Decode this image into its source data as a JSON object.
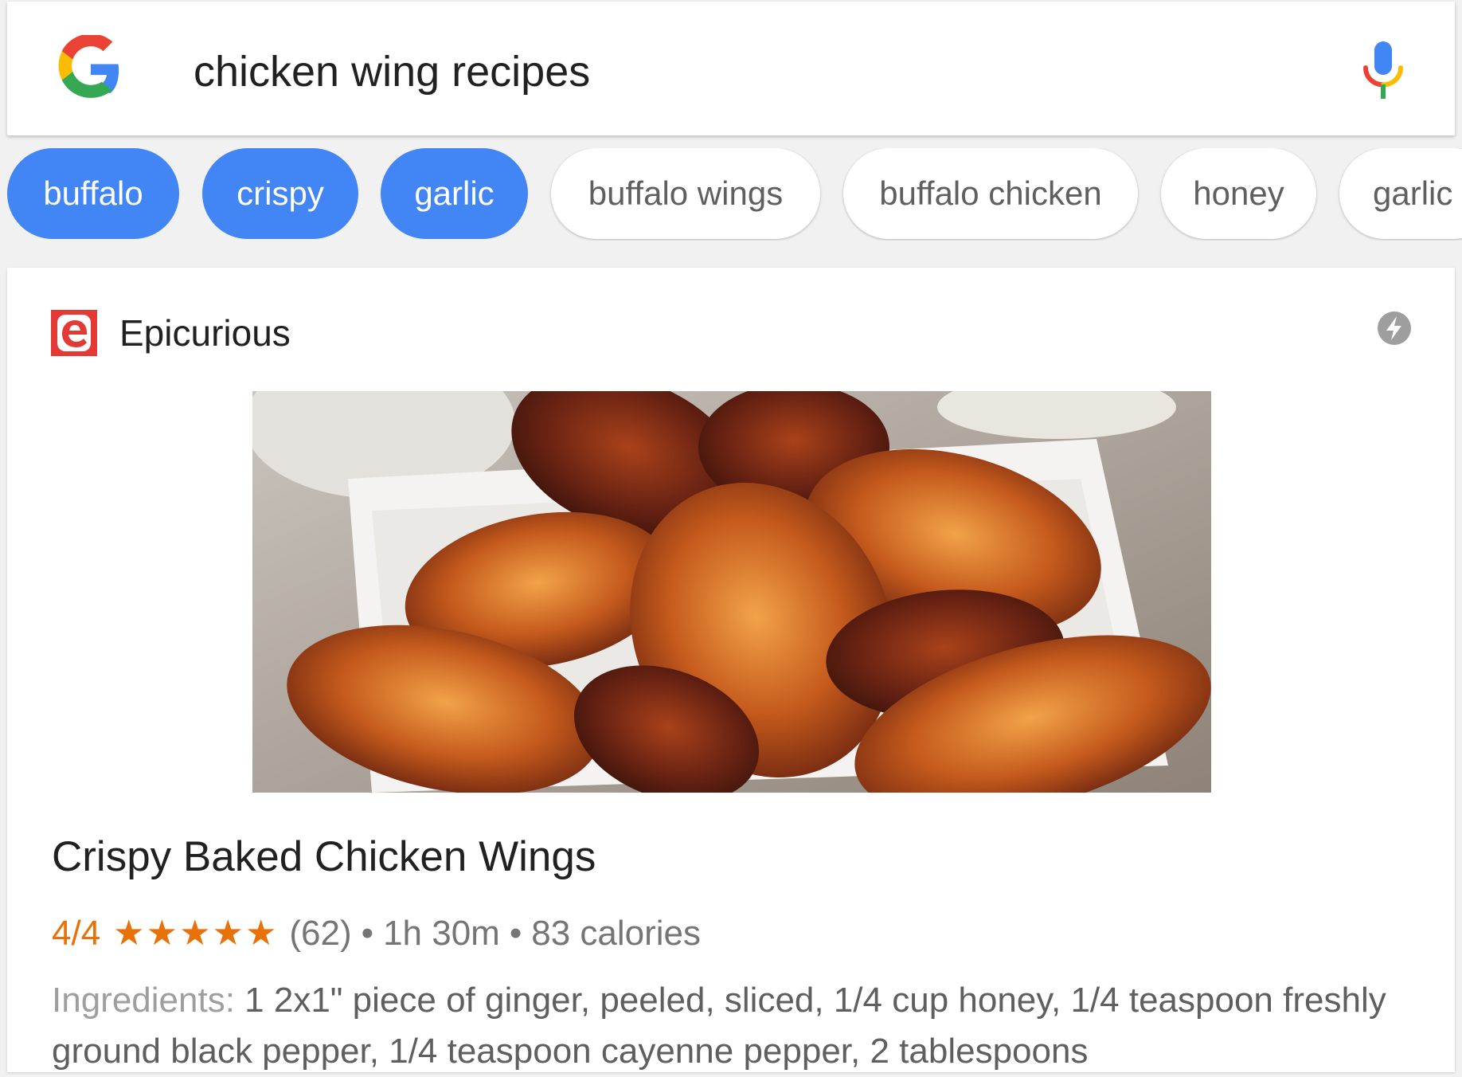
{
  "search": {
    "query": "chicken wing recipes",
    "colors": {
      "blue": "#4285f4",
      "red": "#ea4335",
      "yellow": "#fbbc05",
      "green": "#34a853"
    }
  },
  "chips": [
    {
      "label": "buffalo",
      "active": true
    },
    {
      "label": "crispy",
      "active": true
    },
    {
      "label": "garlic",
      "active": true
    },
    {
      "label": "buffalo wings",
      "active": false
    },
    {
      "label": "buffalo chicken",
      "active": false
    },
    {
      "label": "honey",
      "active": false
    },
    {
      "label": "garlic",
      "active": false
    }
  ],
  "result": {
    "source": "Epicurious",
    "source_icon": "epicurious-logo",
    "amp_icon": "lightning-bolt-icon",
    "image_subject": "baked chicken wings",
    "title": "Crispy Baked Chicken Wings",
    "rating": "4/4",
    "stars": "★★★★★",
    "review_count": "(62)",
    "separator": "•",
    "time": "1h 30m",
    "calories": "83 calories",
    "ingredients_label": "Ingredients:",
    "ingredients_text": "1 2x1\" piece of ginger, peeled, sliced, 1/4 cup honey, 1/4 teaspoon freshly ground black pepper, 1/4 teaspoon cayenne pepper, 2 tablespoons",
    "accent_color": "#e8710a"
  }
}
